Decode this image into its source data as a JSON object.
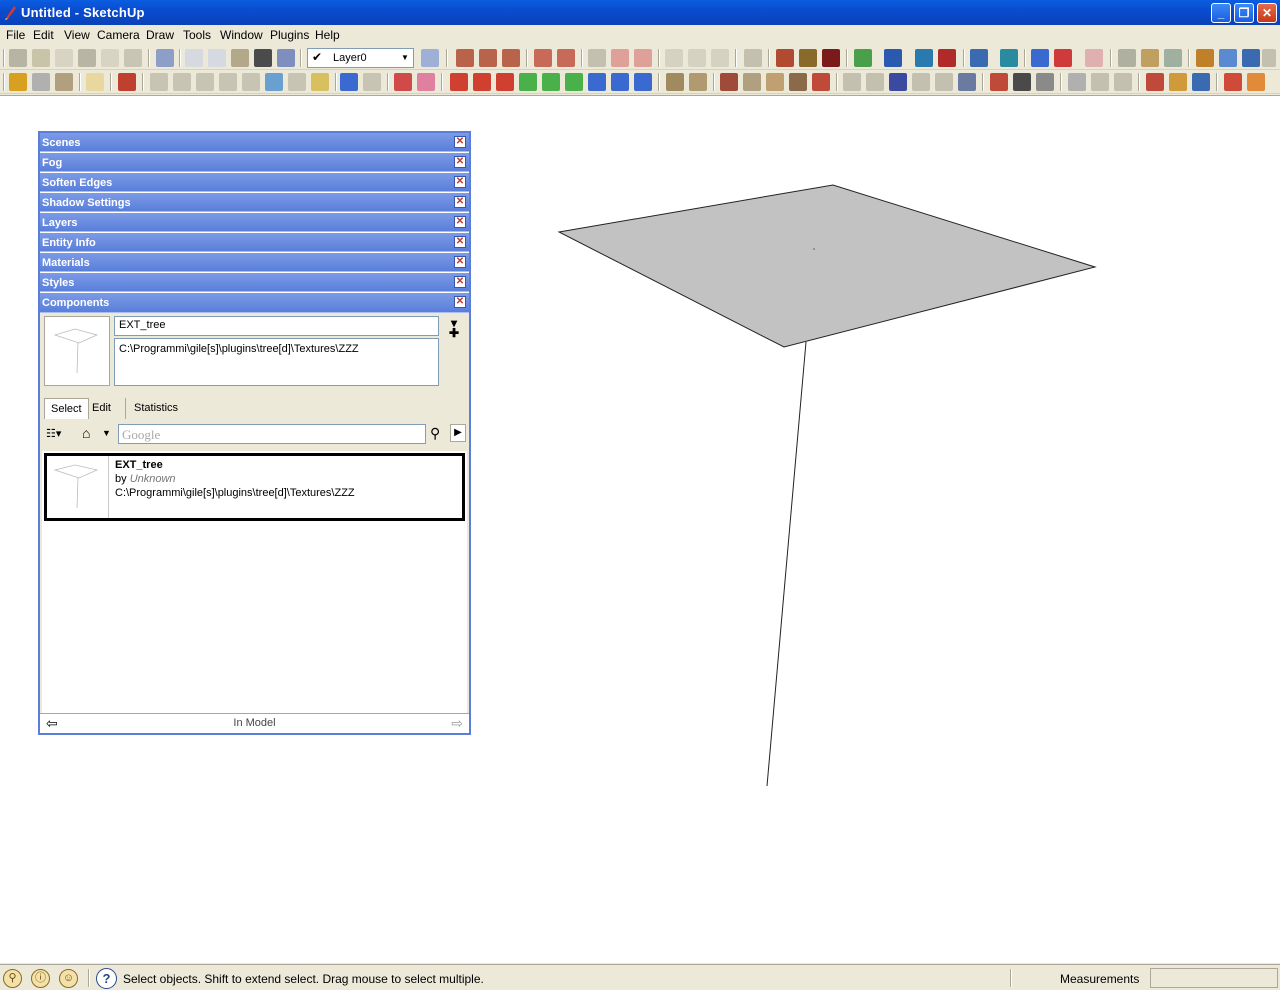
{
  "window": {
    "title": "Untitled - SketchUp",
    "controls": [
      "minimize",
      "maximize",
      "close"
    ]
  },
  "menu": [
    "File",
    "Edit",
    "View",
    "Camera",
    "Draw",
    "Tools",
    "Window",
    "Plugins",
    "Help"
  ],
  "toolbar": {
    "layer_value": "Layer0"
  },
  "tray": {
    "panels": [
      "Scenes",
      "Fog",
      "Soften Edges",
      "Shadow Settings",
      "Layers",
      "Entity Info",
      "Materials",
      "Styles",
      "Components"
    ],
    "components": {
      "name": "EXT_tree",
      "description": "C:\\Programmi\\gile[s]\\plugins\\tree[d]\\Textures\\ZZZ",
      "tabs": [
        "Select",
        "Edit",
        "Statistics"
      ],
      "search_placeholder": "Google",
      "items": [
        {
          "name": "EXT_tree",
          "by_prefix": "by",
          "author": "Unknown",
          "path": "C:\\Programmi\\gile[s]\\plugins\\tree[d]\\Textures\\ZZZ"
        }
      ],
      "location": "In Model"
    }
  },
  "status": {
    "message": "Select objects. Shift to extend select. Drag mouse to select multiple.",
    "measurements_label": "Measurements",
    "measurements_value": ""
  },
  "colors": {
    "titlebar": "#0a4bd0",
    "tray_header": "#5a7fda",
    "face": "#c2c2c2"
  }
}
